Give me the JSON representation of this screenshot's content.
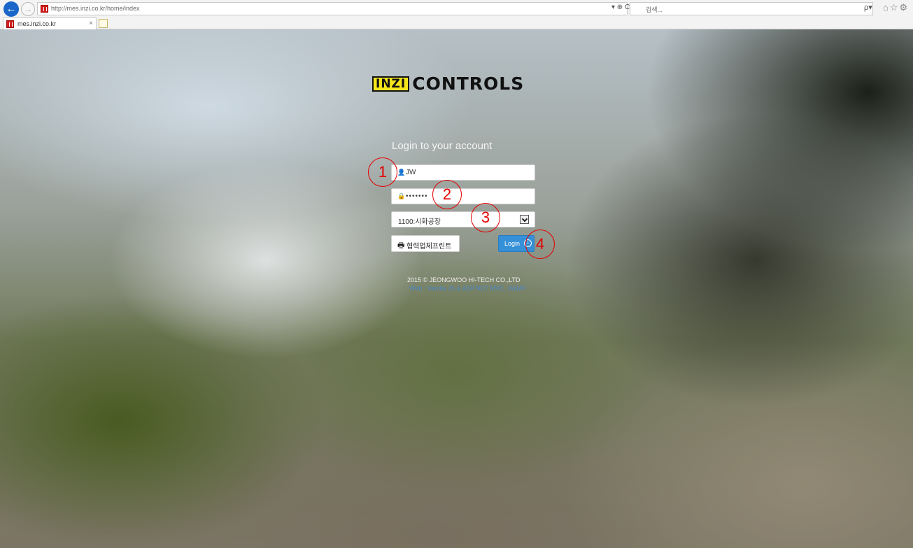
{
  "browser": {
    "url": "http://mes.inzi.co.kr/home/index",
    "url_actions": "▾ ⊕ C",
    "search_placeholder": "검색...",
    "search_go": "ρ▾",
    "toolbar_icons": "⌂☆⚙",
    "tab_title": "mes.inzi.co.kr",
    "tab_close": "×"
  },
  "brand": {
    "box_text": "INZI",
    "name": "CONTROLS",
    "box_color": "#f4e61b"
  },
  "login": {
    "title": "Login to your account",
    "username_value": "JW",
    "password_value": "•••••••",
    "plant_value": "1100:시화공장",
    "print_button_label": "협력업체프린트",
    "login_button_label": "Login",
    "accent_color": "#3590d8"
  },
  "footer": {
    "copyright": "2015 © JEONGWOO HI-TECH CO.,LTD",
    "subtitle": "Web : Vanilla JS & ASP.NET MVC, JWMP"
  },
  "annotations": {
    "marker_1": "1",
    "marker_2": "2",
    "marker_3": "3",
    "marker_4": "4"
  }
}
